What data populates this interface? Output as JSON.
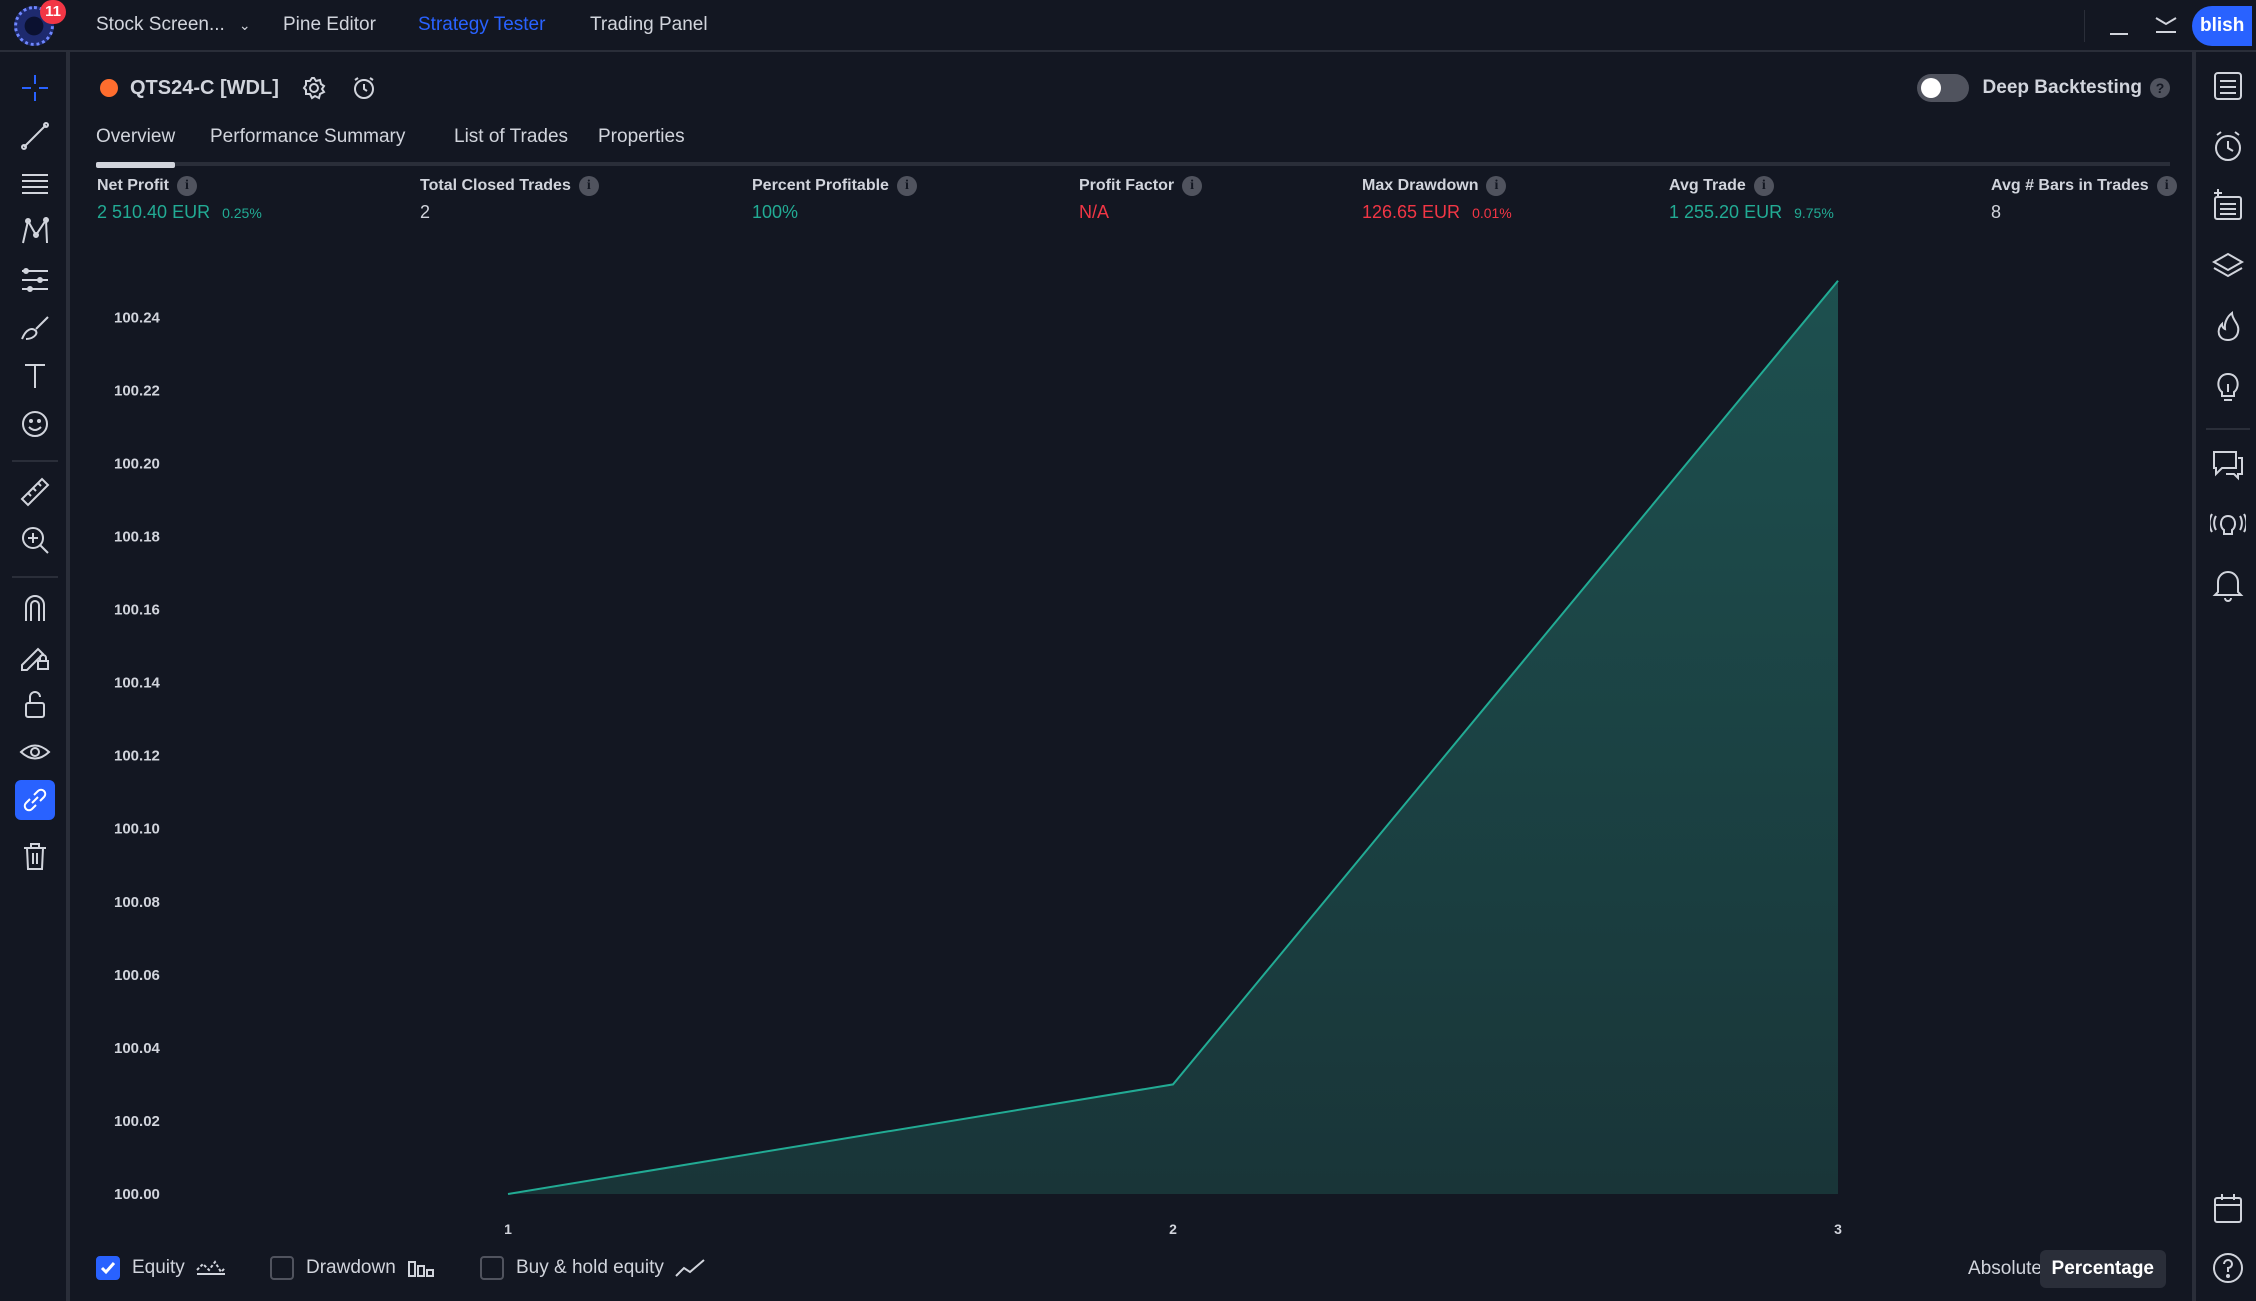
{
  "topbar": {
    "notification_count": "11",
    "tabs": [
      {
        "label": "Stock Screen..."
      },
      {
        "label": "Pine Editor"
      },
      {
        "label": "Strategy Tester"
      },
      {
        "label": "Trading Panel"
      }
    ],
    "active_tab": "Strategy Tester",
    "publish_label": "blish"
  },
  "strategy": {
    "name": "QTS24-C [WDL]",
    "deep_backtesting_label": "Deep Backtesting",
    "deep_backtesting_on": false,
    "help_glyph": "?"
  },
  "subtabs": [
    {
      "label": "Overview"
    },
    {
      "label": "Performance Summary"
    },
    {
      "label": "List of Trades"
    },
    {
      "label": "Properties"
    }
  ],
  "metrics": [
    {
      "label": "Net Profit",
      "value": "2 510.40 EUR",
      "sub": "0.25%",
      "color": "#22ab94"
    },
    {
      "label": "Total Closed Trades",
      "value": "2",
      "sub": "",
      "color": "#d1d4dc"
    },
    {
      "label": "Percent Profitable",
      "value": "100%",
      "sub": "",
      "color": "#22ab94"
    },
    {
      "label": "Profit Factor",
      "value": "N/A",
      "sub": "",
      "color": "#f23645"
    },
    {
      "label": "Max Drawdown",
      "value": "126.65 EUR",
      "sub": "0.01%",
      "color": "#f23645"
    },
    {
      "label": "Avg Trade",
      "value": "1 255.20 EUR",
      "sub": "9.75%",
      "color": "#22ab94"
    },
    {
      "label": "Avg # Bars in Trades",
      "value": "8",
      "sub": "",
      "color": "#d1d4dc"
    }
  ],
  "info_glyph": "i",
  "chart_data": {
    "type": "area",
    "x": [
      1,
      2,
      3
    ],
    "series": [
      {
        "values": [
          100.0,
          100.03,
          100.25
        ],
        "color": "#22ab94"
      }
    ],
    "x_ticks": [
      "1",
      "2",
      "3"
    ],
    "y_ticks": [
      "100.00",
      "100.02",
      "100.04",
      "100.06",
      "100.08",
      "100.10",
      "100.12",
      "100.14",
      "100.16",
      "100.18",
      "100.20",
      "100.22",
      "100.24"
    ],
    "ylim": [
      100.0,
      100.25
    ],
    "xlim": [
      1,
      3
    ],
    "grid": false
  },
  "legend": {
    "items": [
      {
        "label": "Equity",
        "checked": true
      },
      {
        "label": "Drawdown",
        "checked": false
      },
      {
        "label": "Buy & hold equity",
        "checked": false
      }
    ],
    "absolute_label": "Absolute",
    "percentage_label": "Percentage",
    "selected_mode": "Percentage"
  },
  "left_toolbar": {
    "icons": [
      "crosshair-icon",
      "trend-line-icon",
      "fib-retracement-icon",
      "pattern-icon",
      "prediction-icon",
      "brush-icon",
      "text-icon",
      "emoji-icon",
      "ruler-icon",
      "zoom-in-icon",
      "magnet-icon",
      "lock-drawing-icon",
      "lock-icon",
      "eye-icon",
      "link-icon",
      "trash-icon"
    ]
  },
  "right_toolbar": {
    "icons": [
      "watchlist-icon",
      "alert-clock-icon",
      "data-window-icon",
      "layers-icon",
      "hotlist-flame-icon",
      "ideas-bulb-icon",
      "chat-icon",
      "streams-icon",
      "notifications-bell-icon",
      "calendar-icon",
      "help-icon"
    ]
  },
  "colors": {
    "background": "#131722",
    "accent": "#2962ff",
    "positive": "#22ab94",
    "negative": "#f23645",
    "strategy_dot": "#ff6d2e"
  }
}
